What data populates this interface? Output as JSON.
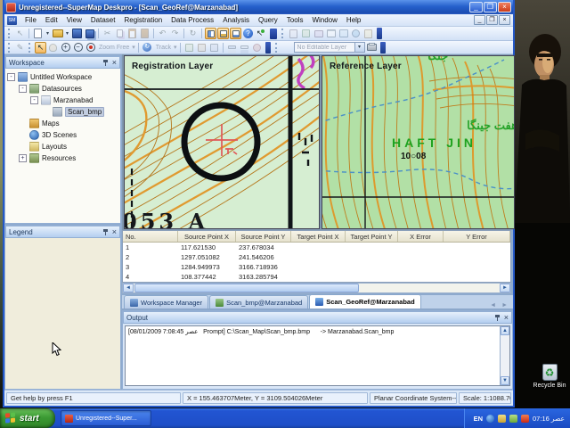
{
  "window": {
    "title": "Unregistered--SuperMap Deskpro - [Scan_GeoRef@Marzanabad]",
    "menus": [
      "File",
      "Edit",
      "View",
      "Dataset",
      "Registration",
      "Data Process",
      "Analysis",
      "Query",
      "Tools",
      "Window",
      "Help"
    ],
    "controls": {
      "minimize": "_",
      "maximize": "❐",
      "close": "×",
      "mdi_minimize": "_",
      "mdi_restore": "❐",
      "mdi_close": "×"
    }
  },
  "toolbar": {
    "zoom_free_label": "Zoom Free",
    "track_label": "Track",
    "editable_layer_value": "No Editable Layer",
    "dropdown_arrow": "▾"
  },
  "glyphs": {
    "cut": "✂",
    "undo": "↶",
    "redo": "↷",
    "refresh": "↻",
    "help": "?",
    "pointer": "↖",
    "zoom_in": "+",
    "zoom_out": "−",
    "left_arrow": "◄",
    "right_arrow": "►",
    "up_arrow": "▲",
    "down_arrow": "▼",
    "recycle": "♻"
  },
  "workspace_panel": {
    "title": "Workspace",
    "tree": [
      {
        "label": "Untitled Workspace",
        "expander": "-"
      },
      {
        "label": "Datasources",
        "expander": "-"
      },
      {
        "label": "Marzanabad",
        "expander": "-"
      },
      {
        "label": "Scan_bmp",
        "expander": ""
      },
      {
        "label": "Maps",
        "expander": ""
      },
      {
        "label": "3D Scenes",
        "expander": ""
      },
      {
        "label": "Layouts",
        "expander": ""
      },
      {
        "label": "Resources",
        "expander": "+"
      }
    ]
  },
  "legend_panel": {
    "title": "Legend"
  },
  "maps": {
    "registration": {
      "label": "Registration Layer",
      "big_text": "053 A"
    },
    "reference": {
      "label": "Reference Layer",
      "persian_text": "هفت جینگا",
      "latin_text": "HAFT JIN",
      "spot_text": "10○08",
      "top_text": "جنگا"
    }
  },
  "points_table": {
    "columns": [
      "No.",
      "Source Point X",
      "Source Point Y",
      "Target Point X",
      "Target Point Y",
      "X Error",
      "Y Error"
    ],
    "rows": [
      [
        "1",
        "117.621530",
        "237.678034",
        "",
        "",
        "",
        ""
      ],
      [
        "2",
        "1297.051082",
        "241.546206",
        "",
        "",
        "",
        ""
      ],
      [
        "3",
        "1284.949973",
        "3166.718936",
        "",
        "",
        "",
        ""
      ],
      [
        "4",
        "108.377442",
        "3163.285794",
        "",
        "",
        "",
        ""
      ]
    ]
  },
  "tabs": [
    {
      "label": "Workspace Manager"
    },
    {
      "label": "Scan_bmp@Marzanabad"
    },
    {
      "label": "Scan_GeoRef@Marzanabad"
    }
  ],
  "output_panel": {
    "title": "Output",
    "log_line": "[08/01/2009 7:08:45 عصر   Prompt] C:\\Scan_Map\\Scan_bmp.bmp      -> Marzanabad.Scan_bmp"
  },
  "status_bar": {
    "help_text": "Get help by press F1",
    "coordinates": "X = 155.463707Meter, Y = 3109.504026Meter",
    "coordinate_system": "Planar Coordinate System---m",
    "scale": "Scale: 1:1088.70"
  },
  "taskbar": {
    "start_label": "start",
    "task_button_label": "Unregistered--Super...",
    "language_indicator": "EN",
    "clock": "07:16 عصر"
  },
  "desktop": {
    "recycle_bin_label": "Recycle Bin"
  },
  "colors": {
    "titlebar_blue": "#2661cc",
    "taskbar_blue": "#2255d2",
    "start_green": "#3c9a34",
    "highlight_orange": "#f4b860",
    "map_bg_registration": "#d6eed2",
    "map_bg_reference": "#b2e0a6",
    "contour_orange": "#c68a28",
    "marker_red": "#e05858"
  }
}
